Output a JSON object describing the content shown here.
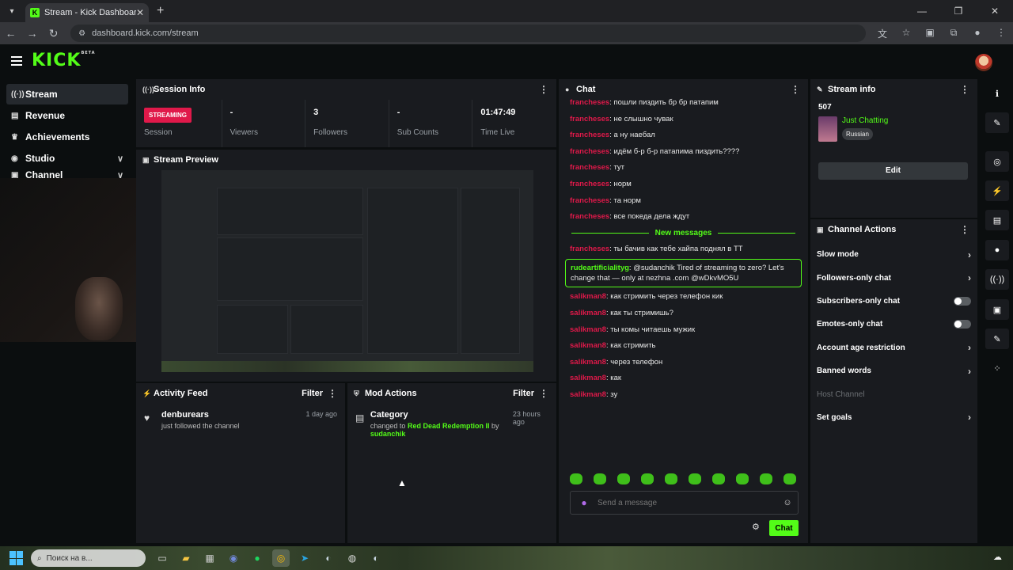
{
  "browser": {
    "tab_title": "Stream - Kick Dashboard",
    "tab_icon_letter": "K",
    "url": "dashboard.kick.com/stream"
  },
  "header": {
    "logo": "KICK",
    "logo_badge": "BETA"
  },
  "sidebar": {
    "items": [
      {
        "label": "Stream",
        "icon": "stream-icon",
        "active": true
      },
      {
        "label": "Revenue",
        "icon": "revenue-icon"
      },
      {
        "label": "Achievements",
        "icon": "trophy-icon"
      },
      {
        "label": "Studio",
        "icon": "studio-icon"
      },
      {
        "label": "Channel",
        "icon": "channel-icon"
      }
    ]
  },
  "session_info": {
    "title": "Session Info",
    "stats": [
      {
        "value": "STREAMING",
        "label": "Session"
      },
      {
        "value": "-",
        "label": "Viewers"
      },
      {
        "value": "3",
        "label": "Followers"
      },
      {
        "value": "-",
        "label": "Sub Counts"
      },
      {
        "value": "01:47:49",
        "label": "Time Live"
      }
    ]
  },
  "stream_preview": {
    "title": "Stream Preview"
  },
  "activity_feed": {
    "title": "Activity Feed",
    "filter_label": "Filter",
    "items": [
      {
        "name": "denburears",
        "sub": "just followed the channel",
        "time": "1 day ago"
      }
    ]
  },
  "mod_actions": {
    "title": "Mod Actions",
    "filter_label": "Filter",
    "items": [
      {
        "name": "Category",
        "sub_prefix": "changed to",
        "target": "Red Dead Redemption II",
        "by_word": "by",
        "by_user": "sudanchik",
        "time": "23 hours ago"
      }
    ]
  },
  "chat": {
    "title": "Chat",
    "messages_before": [
      {
        "user": "francheses",
        "text": "пошли пиздить бр бр патапим"
      },
      {
        "user": "francheses",
        "text": "не слышно чувак"
      },
      {
        "user": "francheses",
        "text": "а ну наебал"
      },
      {
        "user": "francheses",
        "text": "идём б-р б-р патапима пиздить????"
      },
      {
        "user": "francheses",
        "text": "тут"
      },
      {
        "user": "francheses",
        "text": "норм"
      },
      {
        "user": "francheses",
        "text": "та норм"
      },
      {
        "user": "francheses",
        "text": "все покеда дела ждут"
      }
    ],
    "new_messages_label": "New messages",
    "msg_after_divider": {
      "user": "francheses",
      "text": "ты бачив как тебе хайпа поднял в ТТ"
    },
    "highlighted": {
      "user": "rudeartificialityg",
      "text": "@sudanchik Tired of streaming to zero? Let's change that — only at nezhna .com @wDkvMO5U"
    },
    "messages_after": [
      {
        "user": "salikman8",
        "text": "как стримить через телефон кик"
      },
      {
        "user": "salikman8",
        "text": "как ты стримишь?"
      },
      {
        "user": "salikman8",
        "text": "ты комы читаешь мужик"
      },
      {
        "user": "salikman8",
        "text": "как стримить"
      },
      {
        "user": "salikman8",
        "text": "через телефон"
      },
      {
        "user": "salikman8",
        "text": "как"
      },
      {
        "user": "salikman8",
        "text": "зу"
      }
    ],
    "input_placeholder": "Send a message",
    "send_label": "Chat"
  },
  "stream_info": {
    "title": "Stream info",
    "number": "507",
    "category": "Just Chatting",
    "tag": "Russian",
    "edit_label": "Edit"
  },
  "channel_actions": {
    "title": "Channel Actions",
    "items": [
      {
        "label": "Slow mode",
        "control": "chevron"
      },
      {
        "label": "Followers-only chat",
        "control": "chevron"
      },
      {
        "label": "Subscribers-only chat",
        "control": "toggle"
      },
      {
        "label": "Emotes-only chat",
        "control": "toggle"
      },
      {
        "label": "Account age restriction",
        "control": "chevron"
      },
      {
        "label": "Banned words",
        "control": "chevron"
      },
      {
        "label": "Host Channel",
        "control": "none"
      },
      {
        "label": "Set goals",
        "control": "chevron"
      }
    ]
  },
  "taskbar": {
    "search_placeholder": "Поиск на в..."
  },
  "colors": {
    "accent": "#53fc18",
    "live": "#e0194a",
    "panel": "#191b1f",
    "background": "#0b0e0f"
  }
}
